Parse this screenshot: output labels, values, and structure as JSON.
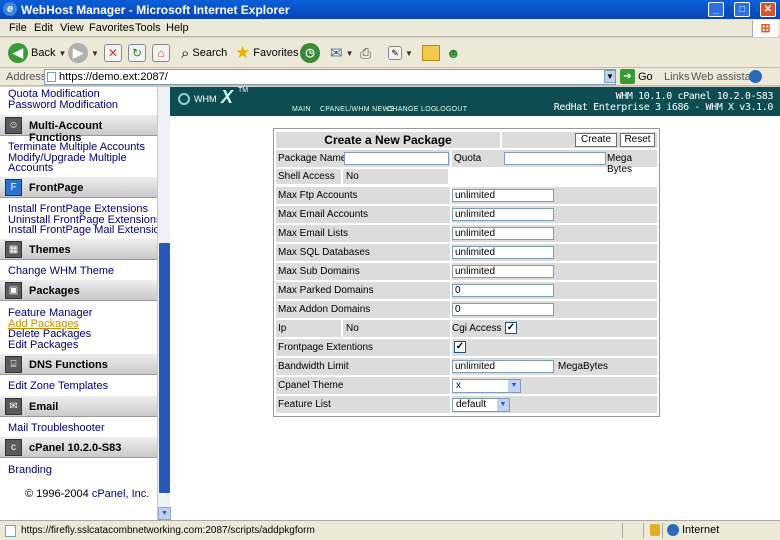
{
  "window": {
    "title": "WebHost Manager - Microsoft Internet Explorer",
    "buttons": {
      "minimize": "_",
      "maximize": "□",
      "close": "✕"
    }
  },
  "menubar": [
    "File",
    "Edit",
    "View",
    "Favorites",
    "Tools",
    "Help"
  ],
  "toolbar": {
    "back": "Back",
    "search": "Search",
    "favorites": "Favorites"
  },
  "address": {
    "label": "Address",
    "url": "https://demo.ext:2087/",
    "go": "Go",
    "links": "Links",
    "assistant": "Web assistant"
  },
  "sidebar": {
    "top_links": [
      "Quota Modification",
      "Password Modification"
    ],
    "sections": [
      {
        "title": "Multi-Account Functions",
        "icon": "users-icon",
        "links": [
          "Terminate Multiple Accounts",
          "Modify/Upgrade Multiple",
          "Accounts"
        ]
      },
      {
        "title": "FrontPage",
        "icon": "frontpage-icon",
        "links": [
          "Install FrontPage Extensions",
          "Uninstall FrontPage Extensions",
          "Install FrontPage Mail Extensions"
        ]
      },
      {
        "title": "Themes",
        "icon": "themes-icon",
        "links": [
          "Change WHM Theme"
        ]
      },
      {
        "title": "Packages",
        "icon": "package-icon",
        "links": [
          "Feature Manager",
          "Add Packages",
          "Delete Packages",
          "Edit Packages"
        ]
      },
      {
        "title": "DNS Functions",
        "icon": "dns-icon",
        "links": [
          "Edit Zone Templates"
        ]
      },
      {
        "title": "Email",
        "icon": "email-icon",
        "links": [
          "Mail Troubleshooter"
        ]
      },
      {
        "title": "cPanel 10.2.0-S83",
        "icon": "cpanel-icon",
        "links": [
          "Branding"
        ]
      }
    ],
    "active_link": "Add Packages",
    "copyright_prefix": "© 1996-2004 ",
    "copyright_company": "cPanel, Inc."
  },
  "banner": {
    "logo_text": "WHM",
    "logo_x": "X",
    "logo_tm": "TM",
    "nav": [
      "MAIN",
      "CPANEL/WHM NEWS",
      "CHANGE LOG",
      "LOGOUT"
    ],
    "version_line1": "WHM 10.1.0 cPanel 10.2.0-S83",
    "version_line2": "RedHat Enterprise 3 i686 - WHM X v3.1.0"
  },
  "form": {
    "heading": "Create a New Package",
    "create_button": "Create",
    "reset_button": "Reset",
    "package_name_label": "Package Name",
    "package_name_value": "",
    "quota_label": "Quota",
    "quota_value": "",
    "quota_unit": "Mega Bytes",
    "shell_access_label": "Shell Access",
    "shell_access_value": "No",
    "fields": [
      {
        "label": "Max Ftp Accounts",
        "value": "unlimited"
      },
      {
        "label": "Max Email Accounts",
        "value": "unlimited"
      },
      {
        "label": "Max Email Lists",
        "value": "unlimited"
      },
      {
        "label": "Max SQL Databases",
        "value": "unlimited"
      },
      {
        "label": "Max Sub Domains",
        "value": "unlimited"
      },
      {
        "label": "Max Parked Domains",
        "value": "0"
      },
      {
        "label": "Max Addon Domains",
        "value": "0"
      }
    ],
    "ip_label": "Ip",
    "ip_value": "No",
    "cgi_label": "Cgi Access",
    "cgi_checked": "✓",
    "frontpage_label": "Frontpage Extentions",
    "frontpage_checked": "✓",
    "bandwidth_label": "Bandwidth Limit",
    "bandwidth_value": "unlimited",
    "bandwidth_unit": "MegaBytes",
    "theme_label": "Cpanel Theme",
    "theme_value": "x",
    "feature_label": "Feature List",
    "feature_value": "default"
  },
  "status": {
    "url": "https://firefly.sslcatacombnetworking.com:2087/scripts/addpkgform",
    "zone": "Internet"
  }
}
